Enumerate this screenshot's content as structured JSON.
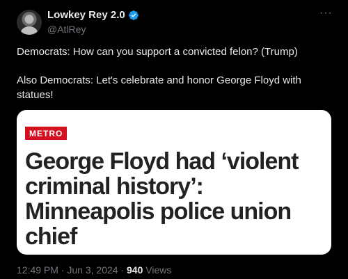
{
  "author": {
    "name": "Lowkey Rey 2.0",
    "handle": "@AtlRey"
  },
  "tweet": {
    "line1": "Democrats: How can you support a convicted felon? (Trump)",
    "line2": "Also Democrats: Let's celebrate and honor George Floyd with statues!"
  },
  "media": {
    "badge": "METRO",
    "headline": "George Floyd had ‘violent criminal history’: Minneapolis police union chief"
  },
  "meta": {
    "time": "12:49 PM",
    "sep1": "·",
    "date": "Jun 3, 2024",
    "sep2": "·",
    "views_count": "940",
    "views_label": "Views"
  },
  "colors": {
    "background": "#000000",
    "verified": "#1d9bf0",
    "badge": "#d4111e",
    "muted_text": "#71767b"
  },
  "icons": {
    "verified": "verified-badge-icon",
    "more": "more-options-icon"
  }
}
